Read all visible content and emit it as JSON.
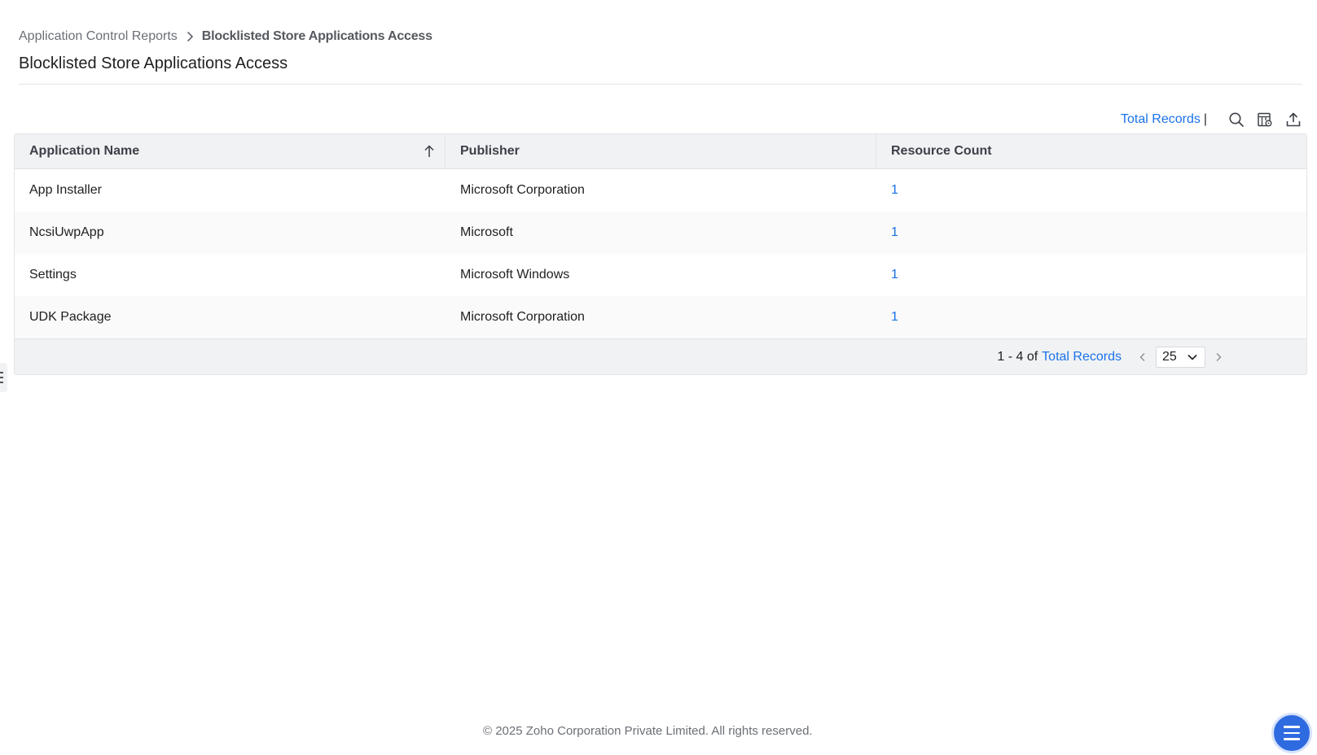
{
  "breadcrumb": {
    "parent": "Application Control Reports",
    "current": "Blocklisted Store Applications Access"
  },
  "page_title": "Blocklisted Store Applications Access",
  "toolbar": {
    "total_records_label": "Total Records",
    "separator": "|",
    "icons": [
      "search-icon",
      "column-settings-icon",
      "export-icon"
    ]
  },
  "table": {
    "columns": [
      "Application Name",
      "Publisher",
      "Resource Count"
    ],
    "sort": {
      "column": "Application Name",
      "direction": "ascending"
    },
    "rows": [
      {
        "application_name": "App Installer",
        "publisher": "Microsoft Corporation",
        "resource_count": "1"
      },
      {
        "application_name": "NcsiUwpApp",
        "publisher": "Microsoft",
        "resource_count": "1"
      },
      {
        "application_name": "Settings",
        "publisher": "Microsoft Windows",
        "resource_count": "1"
      },
      {
        "application_name": "UDK Package",
        "publisher": "Microsoft Corporation",
        "resource_count": "1"
      }
    ]
  },
  "pagination": {
    "range": "1 - 4 of",
    "total_records_label": "Total Records",
    "page_size": "25"
  },
  "footer": {
    "copyright": "© 2025 Zoho Corporation Private Limited. All rights reserved."
  },
  "colors": {
    "link": "#1a73e8",
    "header_bg": "#f1f2f4",
    "fab": "#2f6be0"
  }
}
